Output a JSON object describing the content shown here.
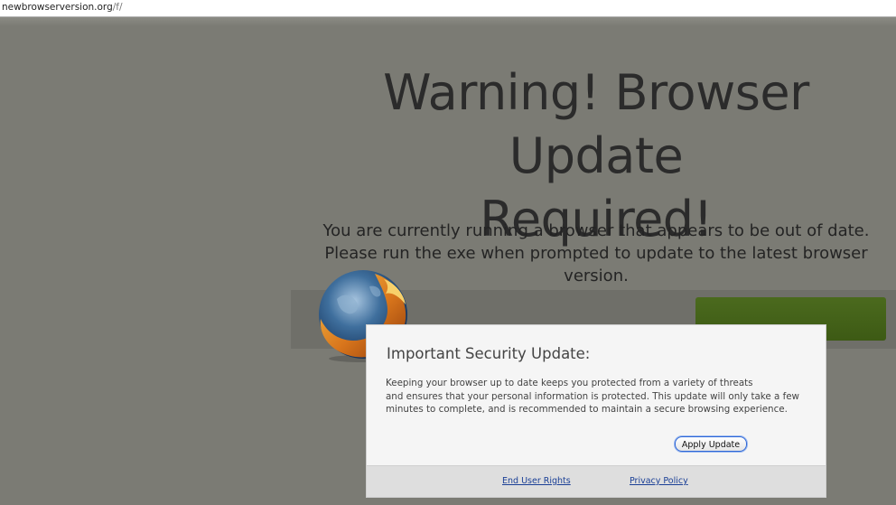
{
  "browser": {
    "url_host": "newbrowserversion.org",
    "url_path": "/f/"
  },
  "page": {
    "headline_line1": "Warning! Browser Update",
    "headline_line2": "Required!",
    "sub_line1": "You are currently running a browser that appears to be out of date.",
    "sub_line2": "Please run the exe when prompted to update to the latest browser version."
  },
  "dialog": {
    "title": "Important Security Update:",
    "body_line1": "Keeping your browser up to date keeps you protected from a variety of threats",
    "body_line2": "and ensures that your personal information is protected.  This update will only take a few",
    "body_line3": "minutes to complete, and is recommended to maintain a secure browsing experience.",
    "apply_label": "Apply Update",
    "eula_label": "End User Rights",
    "privacy_label": "Privacy Policy"
  },
  "colors": {
    "overlay": "#7b7b74",
    "green_button": "#4b6a1e",
    "link": "#1a3f96",
    "button_focus": "#2f67d6"
  },
  "icons": {
    "browser_logo": "firefox-globe-icon"
  }
}
